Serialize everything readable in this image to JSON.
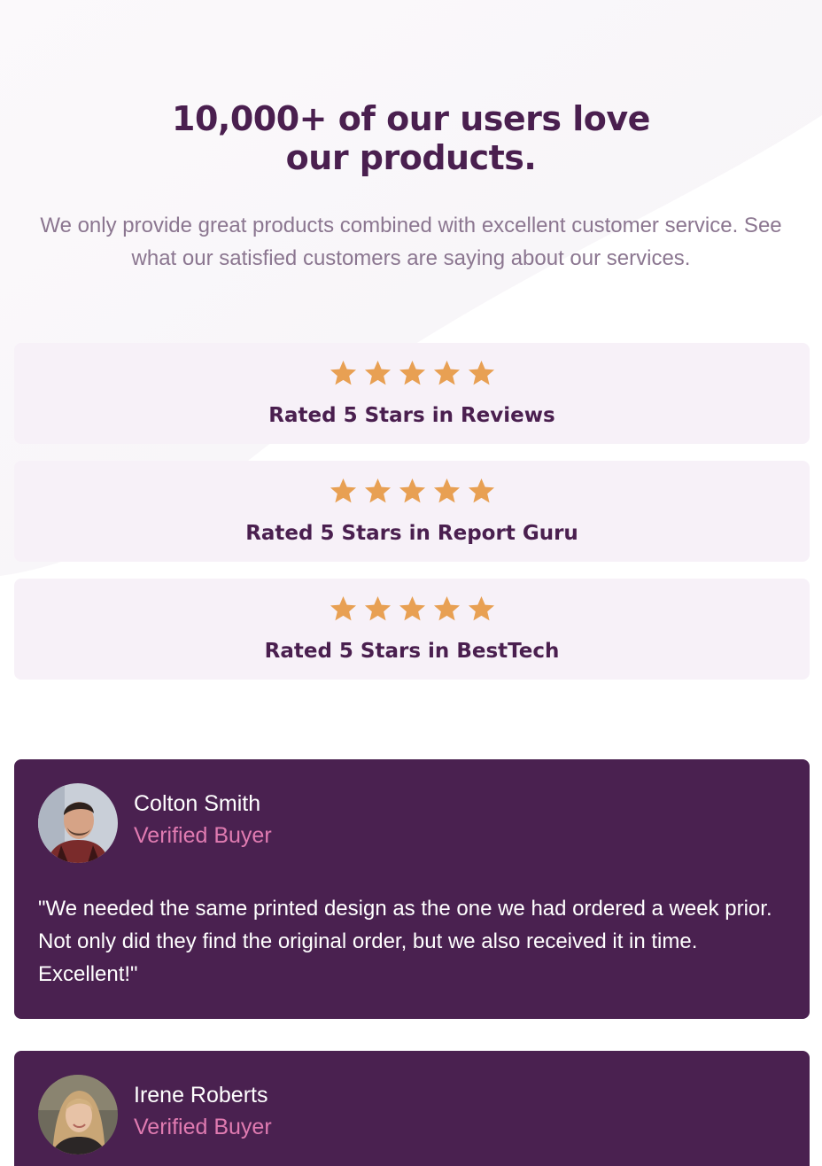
{
  "hero": {
    "title": "10,000+ of our users love our products.",
    "description": "We only provide great products combined with excellent customer service. See what our satisfied customers are saying about our services."
  },
  "ratings": [
    {
      "stars": 5,
      "label": "Rated 5 Stars in Reviews"
    },
    {
      "stars": 5,
      "label": "Rated 5 Stars in Report Guru"
    },
    {
      "stars": 5,
      "label": "Rated 5 Stars in BestTech"
    }
  ],
  "testimonials": [
    {
      "name": "Colton Smith",
      "role": "Verified Buyer",
      "quote": "\"We needed the same printed design as the one we had ordered a week prior. Not only did they find the original order, but we also received it in time. Excellent!\""
    },
    {
      "name": "Irene Roberts",
      "role": "Verified Buyer"
    }
  ],
  "colors": {
    "heading": "#4a1f4f",
    "body_text": "#8b7690",
    "card_bg": "#f7f1f8",
    "star": "#e8a053",
    "testimonial_bg": "#4a2150",
    "accent_pink": "#e07bb1"
  }
}
